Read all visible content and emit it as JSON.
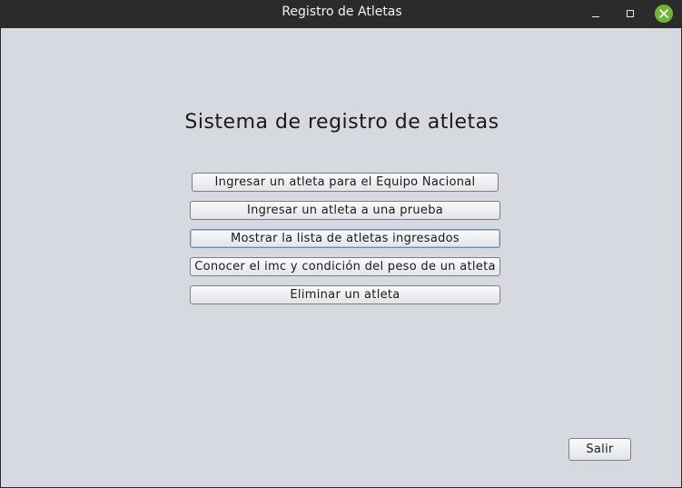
{
  "window": {
    "title": "Registro de Atletas",
    "close_color": "#6fb536"
  },
  "main": {
    "heading": "Sistema de registro de atletas",
    "buttons": [
      {
        "label": "Ingresar un atleta para el Equipo Nacional"
      },
      {
        "label": "Ingresar un atleta a una prueba"
      },
      {
        "label": "Mostrar la lista de atletas ingresados"
      },
      {
        "label": "Conocer el imc y condición del peso de un atleta"
      },
      {
        "label": "Eliminar un atleta"
      }
    ],
    "exit_label": "Salir"
  }
}
